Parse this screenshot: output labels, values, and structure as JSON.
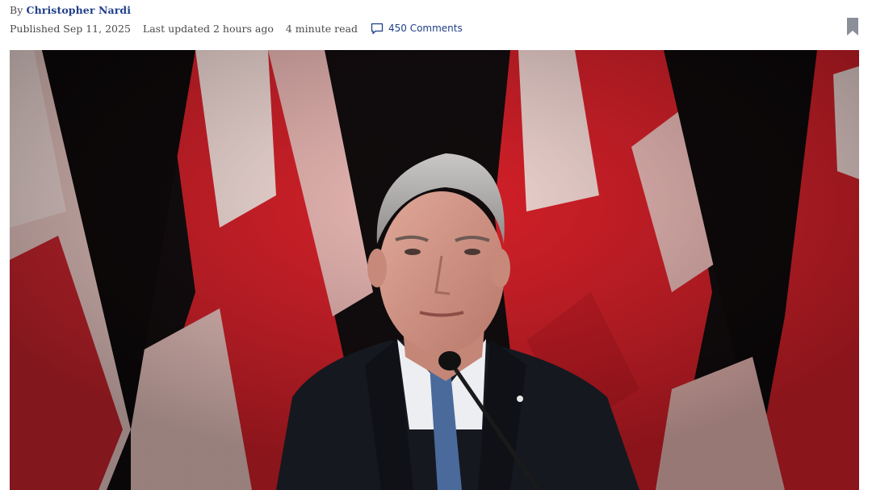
{
  "byline": {
    "prefix": "By",
    "author": "Christopher Nardi"
  },
  "meta": {
    "published": "Published Sep 11, 2025",
    "updated": "Last updated 2 hours ago",
    "read_time": "4 minute read",
    "comments": "450 Comments"
  },
  "icons": {
    "comments": "speech-bubble-icon",
    "bookmark": "bookmark-icon"
  },
  "colors": {
    "link": "#1f3e8a",
    "bookmark": "#8a8f98",
    "flag_red": "#d8202a",
    "flag_white": "#f3dcd8"
  }
}
